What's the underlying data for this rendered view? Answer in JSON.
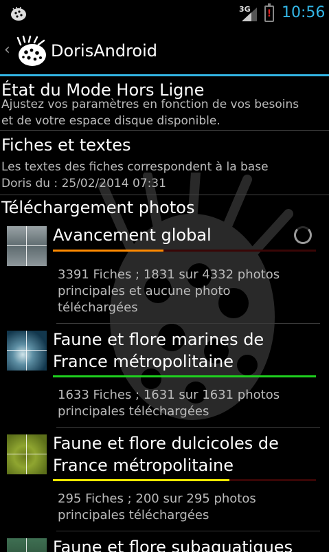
{
  "status_bar": {
    "network": "3G",
    "battery_alert": "!",
    "time": "10:56"
  },
  "action_bar": {
    "back_icon": "chevron-left-icon",
    "logo_icon": "doris-logo-icon",
    "title": "DorisAndroid"
  },
  "sections": {
    "offline_mode": {
      "title": "État du Mode Hors Ligne",
      "description_line1": "Ajustez vos paramètres en fonction de vos besoins",
      "description_line2": "et de votre espace disque disponible."
    },
    "sheets": {
      "title": "Fiches et textes",
      "description_line1": "Les textes des fiches correspondent à la base",
      "description_line2": "Doris du : 25/02/2014  07:31"
    },
    "photos": {
      "title": "Téléchargement photos"
    }
  },
  "items": [
    {
      "title_line1": "Avancement global",
      "title_line2": "",
      "progress": 0.42,
      "bar_color": "#ff8a00",
      "loading": true,
      "desc_line1": "3391 Fiches ; 1831 sur 4332 photos",
      "desc_line2": "principales et aucune photo",
      "desc_line3": "téléchargées"
    },
    {
      "title_line1": "Faune et flore marines de",
      "title_line2": "France métropolitaine",
      "progress": 1.0,
      "bar_color": "#1fd11f",
      "desc_line1": "1633 Fiches ; 1631 sur 1631 photos",
      "desc_line2": "principales téléchargées"
    },
    {
      "title_line1": "Faune et flore dulcicoles de",
      "title_line2": "France métropolitaine",
      "progress": 0.67,
      "bar_color": "#f4ea00",
      "desc_line1": "295 Fiches ; 200 sur 295 photos",
      "desc_line2": "principales téléchargées"
    },
    {
      "title_line1": "Faune et flore subaquatiques"
    }
  ],
  "colors": {
    "accent": "#33b5e5",
    "background": "#000000"
  }
}
